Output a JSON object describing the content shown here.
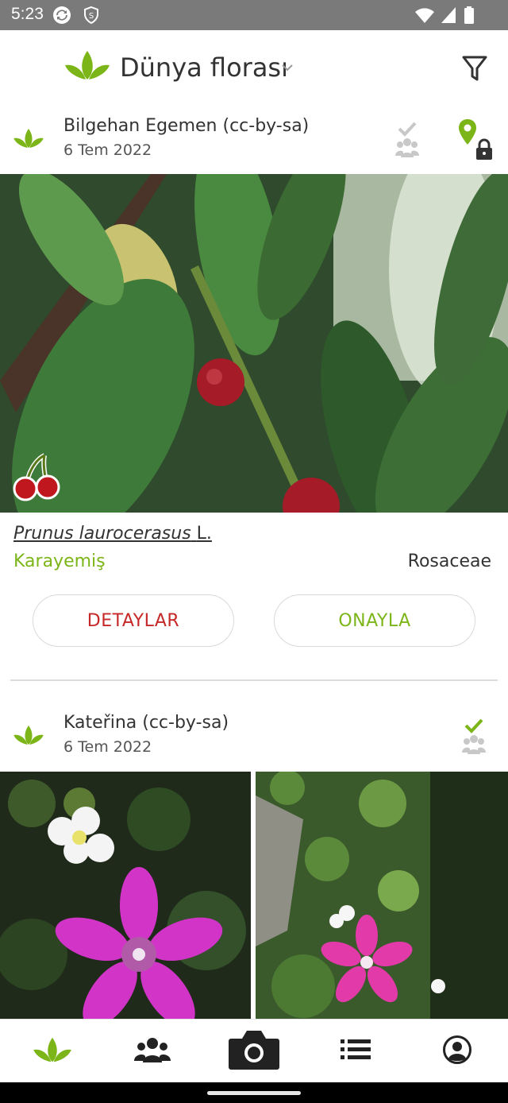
{
  "status_bar": {
    "time": "5:23",
    "icons": [
      "sync-icon",
      "shield-icon",
      "wifi-icon",
      "signal-icon",
      "battery-icon"
    ]
  },
  "header": {
    "title": "Dünya florası",
    "logo_icon": "leaf-logo-icon",
    "filter_icon": "filter-icon"
  },
  "observations": [
    {
      "author": "Bilgehan Egemen (cc-by-sa)",
      "date": "6 Tem 2022",
      "status_icons": [
        "check-icon",
        "group-icon",
        "location-pin-icon",
        "lock-icon"
      ],
      "organ_icon": "cherry-icon",
      "scientific_name": "Prunus laurocerasus",
      "authority": "L.",
      "common_name": "Karayemiş",
      "family": "Rosaceae",
      "details_label": "DETAYLAR",
      "confirm_label": "ONAYLA"
    },
    {
      "author": "Kateřina (cc-by-sa)",
      "date": "6 Tem 2022",
      "status_icons": [
        "check-icon",
        "group-icon"
      ]
    }
  ],
  "bottom_nav": {
    "items": [
      "leaf-icon",
      "community-icon",
      "camera-icon",
      "list-icon",
      "profile-icon"
    ]
  },
  "colors": {
    "accent_green": "#7cb518",
    "details_red": "#c62828",
    "status_bar": "#7a7a7a"
  }
}
